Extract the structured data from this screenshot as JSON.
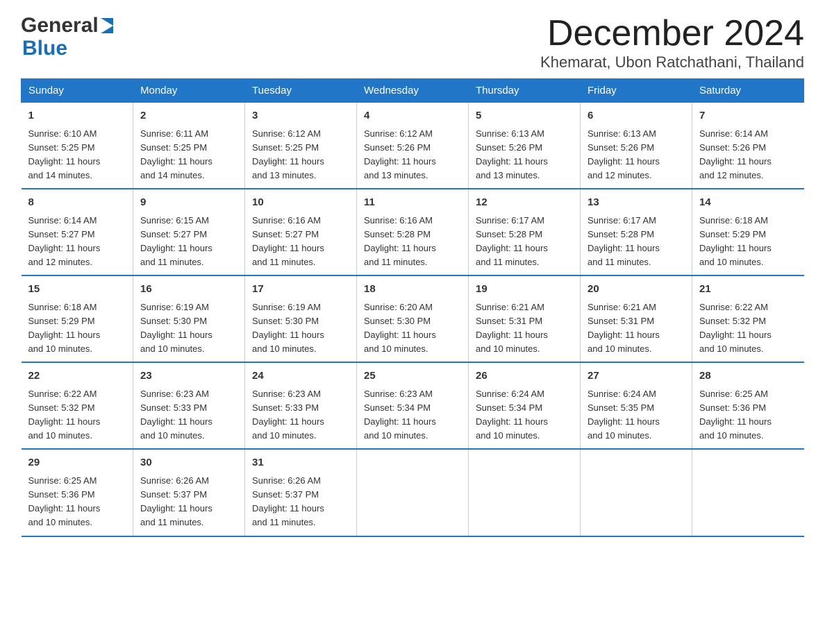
{
  "header": {
    "month_year": "December 2024",
    "location": "Khemarat, Ubon Ratchathani, Thailand",
    "logo_part1": "General",
    "logo_part2": "Blue"
  },
  "days_of_week": [
    "Sunday",
    "Monday",
    "Tuesday",
    "Wednesday",
    "Thursday",
    "Friday",
    "Saturday"
  ],
  "weeks": [
    [
      {
        "day": "1",
        "sunrise": "6:10 AM",
        "sunset": "5:25 PM",
        "daylight": "11 hours and 14 minutes."
      },
      {
        "day": "2",
        "sunrise": "6:11 AM",
        "sunset": "5:25 PM",
        "daylight": "11 hours and 14 minutes."
      },
      {
        "day": "3",
        "sunrise": "6:12 AM",
        "sunset": "5:25 PM",
        "daylight": "11 hours and 13 minutes."
      },
      {
        "day": "4",
        "sunrise": "6:12 AM",
        "sunset": "5:26 PM",
        "daylight": "11 hours and 13 minutes."
      },
      {
        "day": "5",
        "sunrise": "6:13 AM",
        "sunset": "5:26 PM",
        "daylight": "11 hours and 13 minutes."
      },
      {
        "day": "6",
        "sunrise": "6:13 AM",
        "sunset": "5:26 PM",
        "daylight": "11 hours and 12 minutes."
      },
      {
        "day": "7",
        "sunrise": "6:14 AM",
        "sunset": "5:26 PM",
        "daylight": "11 hours and 12 minutes."
      }
    ],
    [
      {
        "day": "8",
        "sunrise": "6:14 AM",
        "sunset": "5:27 PM",
        "daylight": "11 hours and 12 minutes."
      },
      {
        "day": "9",
        "sunrise": "6:15 AM",
        "sunset": "5:27 PM",
        "daylight": "11 hours and 11 minutes."
      },
      {
        "day": "10",
        "sunrise": "6:16 AM",
        "sunset": "5:27 PM",
        "daylight": "11 hours and 11 minutes."
      },
      {
        "day": "11",
        "sunrise": "6:16 AM",
        "sunset": "5:28 PM",
        "daylight": "11 hours and 11 minutes."
      },
      {
        "day": "12",
        "sunrise": "6:17 AM",
        "sunset": "5:28 PM",
        "daylight": "11 hours and 11 minutes."
      },
      {
        "day": "13",
        "sunrise": "6:17 AM",
        "sunset": "5:28 PM",
        "daylight": "11 hours and 11 minutes."
      },
      {
        "day": "14",
        "sunrise": "6:18 AM",
        "sunset": "5:29 PM",
        "daylight": "11 hours and 10 minutes."
      }
    ],
    [
      {
        "day": "15",
        "sunrise": "6:18 AM",
        "sunset": "5:29 PM",
        "daylight": "11 hours and 10 minutes."
      },
      {
        "day": "16",
        "sunrise": "6:19 AM",
        "sunset": "5:30 PM",
        "daylight": "11 hours and 10 minutes."
      },
      {
        "day": "17",
        "sunrise": "6:19 AM",
        "sunset": "5:30 PM",
        "daylight": "11 hours and 10 minutes."
      },
      {
        "day": "18",
        "sunrise": "6:20 AM",
        "sunset": "5:30 PM",
        "daylight": "11 hours and 10 minutes."
      },
      {
        "day": "19",
        "sunrise": "6:21 AM",
        "sunset": "5:31 PM",
        "daylight": "11 hours and 10 minutes."
      },
      {
        "day": "20",
        "sunrise": "6:21 AM",
        "sunset": "5:31 PM",
        "daylight": "11 hours and 10 minutes."
      },
      {
        "day": "21",
        "sunrise": "6:22 AM",
        "sunset": "5:32 PM",
        "daylight": "11 hours and 10 minutes."
      }
    ],
    [
      {
        "day": "22",
        "sunrise": "6:22 AM",
        "sunset": "5:32 PM",
        "daylight": "11 hours and 10 minutes."
      },
      {
        "day": "23",
        "sunrise": "6:23 AM",
        "sunset": "5:33 PM",
        "daylight": "11 hours and 10 minutes."
      },
      {
        "day": "24",
        "sunrise": "6:23 AM",
        "sunset": "5:33 PM",
        "daylight": "11 hours and 10 minutes."
      },
      {
        "day": "25",
        "sunrise": "6:23 AM",
        "sunset": "5:34 PM",
        "daylight": "11 hours and 10 minutes."
      },
      {
        "day": "26",
        "sunrise": "6:24 AM",
        "sunset": "5:34 PM",
        "daylight": "11 hours and 10 minutes."
      },
      {
        "day": "27",
        "sunrise": "6:24 AM",
        "sunset": "5:35 PM",
        "daylight": "11 hours and 10 minutes."
      },
      {
        "day": "28",
        "sunrise": "6:25 AM",
        "sunset": "5:36 PM",
        "daylight": "11 hours and 10 minutes."
      }
    ],
    [
      {
        "day": "29",
        "sunrise": "6:25 AM",
        "sunset": "5:36 PM",
        "daylight": "11 hours and 10 minutes."
      },
      {
        "day": "30",
        "sunrise": "6:26 AM",
        "sunset": "5:37 PM",
        "daylight": "11 hours and 11 minutes."
      },
      {
        "day": "31",
        "sunrise": "6:26 AM",
        "sunset": "5:37 PM",
        "daylight": "11 hours and 11 minutes."
      },
      null,
      null,
      null,
      null
    ]
  ],
  "labels": {
    "sunrise": "Sunrise:",
    "sunset": "Sunset:",
    "daylight": "Daylight:"
  }
}
